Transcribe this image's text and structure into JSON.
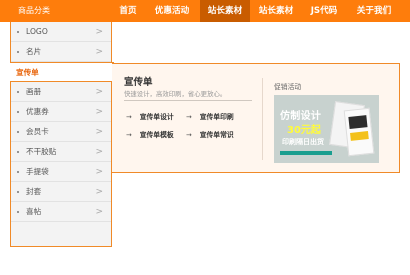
{
  "category_header": "商品分类",
  "nav": {
    "items": [
      {
        "label": "首页"
      },
      {
        "label": "优惠活动"
      },
      {
        "label": "站长素材",
        "active": true
      },
      {
        "label": "站长素材"
      },
      {
        "label": "JS代码"
      },
      {
        "label": "关于我们"
      }
    ]
  },
  "categories": [
    {
      "label": "LOGO"
    },
    {
      "label": "名片"
    },
    {
      "label": "宣传单",
      "active": true
    },
    {
      "label": "画册"
    },
    {
      "label": "优惠券"
    },
    {
      "label": "会员卡"
    },
    {
      "label": "不干胶贴"
    },
    {
      "label": "手提袋"
    },
    {
      "label": "封套"
    },
    {
      "label": "喜帖"
    }
  ],
  "panel": {
    "title": "宣传单",
    "subtitle": "快速设计，高效印刷，省心更放心。",
    "links": [
      {
        "label": "宣传单设计"
      },
      {
        "label": "宣传单印刷"
      },
      {
        "label": "宣传单模板"
      },
      {
        "label": "宣传单常识"
      }
    ],
    "promo_title": "促销活动",
    "banner": {
      "line1": "仿制设计",
      "line2": "30元起",
      "line3": "印刷隔日出货"
    }
  },
  "colors": {
    "accent": "#fe7d0c",
    "active_nav": "#c95c00",
    "panel_bg": "#fff6ee",
    "border": "#f08a28"
  }
}
